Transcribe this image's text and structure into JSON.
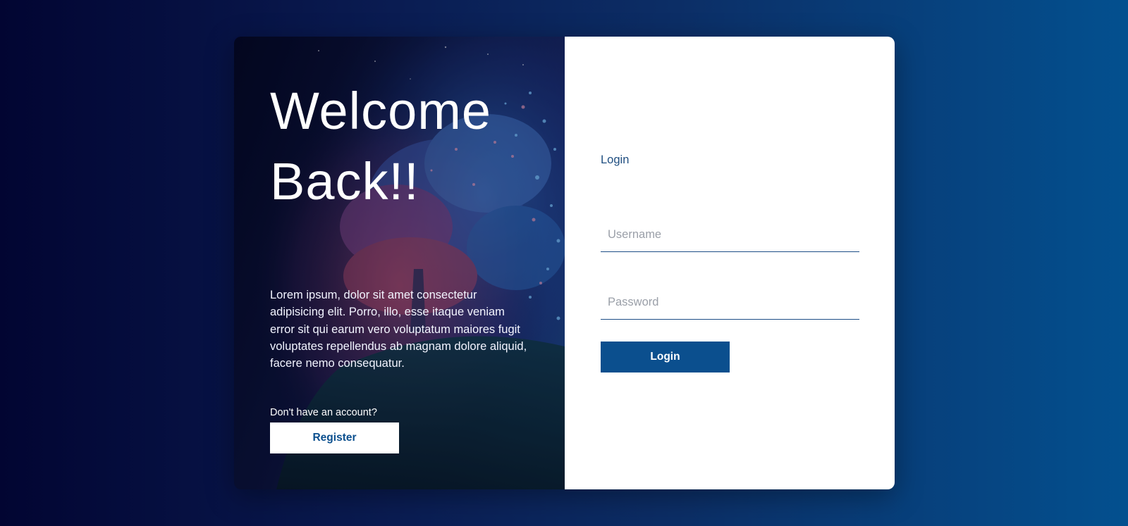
{
  "welcome": {
    "heading": "Welcome Back!!",
    "description": "Lorem ipsum, dolor sit amet consectetur adipisicing elit. Porro, illo, esse itaque veniam error sit qui earum vero voluptatum maiores fugit voluptates repellendus ab magnam dolore aliquid, facere nemo consequatur.",
    "no_account_text": "Don't have an account?",
    "register_label": "Register"
  },
  "login": {
    "title": "Login",
    "username_placeholder": "Username",
    "username_value": "",
    "password_placeholder": "Password",
    "password_value": "",
    "submit_label": "Login"
  },
  "colors": {
    "accent": "#0b4f8e",
    "background_start": "#020532",
    "background_end": "#03508f",
    "field_underline": "#1d4e86"
  }
}
